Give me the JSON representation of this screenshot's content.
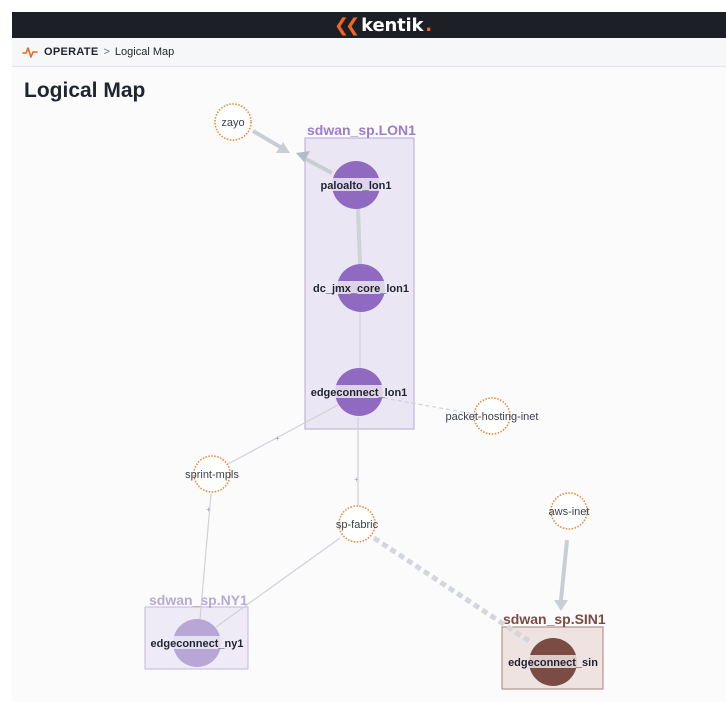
{
  "brand": {
    "name": "kentik",
    "dot": "."
  },
  "breadcrumb": {
    "section": "OPERATE",
    "separator": ">",
    "current": "Logical Map"
  },
  "page": {
    "title": "Logical Map"
  },
  "colors": {
    "lon1": "#8f6ac0",
    "ny1": "#b7a6d6",
    "sin1": "#7a4c44",
    "external_ring": "#e8893a",
    "link": "#c9cdd4"
  },
  "sites": [
    {
      "id": "lon1",
      "label": "sdwan_sp.LON1"
    },
    {
      "id": "ny1",
      "label": "sdwan_sp.NY1"
    },
    {
      "id": "sin1",
      "label": "sdwan_sp.SIN1"
    }
  ],
  "devices": [
    {
      "id": "paloalto_lon1",
      "label": "paloalto_lon1",
      "site": "lon1"
    },
    {
      "id": "dc_jmx_core_lon1",
      "label": "dc_jmx_core_lon1",
      "site": "lon1"
    },
    {
      "id": "edgeconnect_lon1",
      "label": "edgeconnect_lon1",
      "site": "lon1"
    },
    {
      "id": "edgeconnect_ny1",
      "label": "edgeconnect_ny1",
      "site": "ny1"
    },
    {
      "id": "edgeconnect_sin",
      "label": "edgeconnect_sin",
      "site": "sin1"
    }
  ],
  "externals": [
    {
      "id": "zayo",
      "label": "zayo"
    },
    {
      "id": "packet-hosting-inet",
      "label": "packet-hosting-inet"
    },
    {
      "id": "sprint-mpls",
      "label": "sprint-mpls"
    },
    {
      "id": "sp-fabric",
      "label": "sp-fabric"
    },
    {
      "id": "aws-inet",
      "label": "aws-inet"
    }
  ],
  "links": [
    {
      "from": "zayo",
      "to": "paloalto_lon1",
      "style": "arrow-thick"
    },
    {
      "from": "paloalto_lon1",
      "to": "dc_jmx_core_lon1",
      "style": "thick"
    },
    {
      "from": "dc_jmx_core_lon1",
      "to": "edgeconnect_lon1",
      "style": "thin"
    },
    {
      "from": "edgeconnect_lon1",
      "to": "packet-hosting-inet",
      "style": "dashed"
    },
    {
      "from": "edgeconnect_lon1",
      "to": "sprint-mpls",
      "style": "thin"
    },
    {
      "from": "edgeconnect_lon1",
      "to": "sp-fabric",
      "style": "thin"
    },
    {
      "from": "sprint-mpls",
      "to": "edgeconnect_ny1",
      "style": "thin"
    },
    {
      "from": "sp-fabric",
      "to": "edgeconnect_ny1",
      "style": "thin"
    },
    {
      "from": "sp-fabric",
      "to": "edgeconnect_sin",
      "style": "dashed-thick"
    },
    {
      "from": "aws-inet",
      "to": "edgeconnect_sin",
      "style": "arrow-thick"
    }
  ]
}
